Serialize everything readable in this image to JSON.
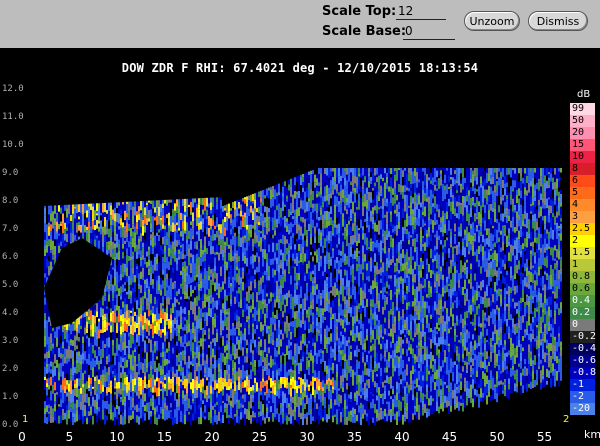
{
  "toolbar": {
    "scale_top_label": "Scale Top:",
    "scale_top_value": "12",
    "scale_base_label": "Scale Base:",
    "scale_base_value": "0",
    "unzoom_label": "Unzoom",
    "dismiss_label": "Dismiss"
  },
  "plot": {
    "title": "DOW ZDR F  RHI: 67.4021 deg  -  12/10/2015 18:13:54",
    "x_unit": "km",
    "y_ticks": [
      "12.0",
      "11.0",
      "10.0",
      "9.0",
      "8.0",
      "7.0",
      "6.0",
      "5.0",
      "4.0",
      "3.0",
      "2.0",
      "1.0",
      "0.0"
    ],
    "x_ticks": [
      "0",
      "5",
      "10",
      "15",
      "20",
      "25",
      "30",
      "35",
      "40",
      "45",
      "50",
      "55"
    ],
    "corner_left": "1",
    "corner_right": "2"
  },
  "colorbar": {
    "unit": "dB",
    "entries": [
      {
        "label": "99",
        "color": "#ffd8e4"
      },
      {
        "label": "50",
        "color": "#ffb0c8"
      },
      {
        "label": "20",
        "color": "#ff8fb0"
      },
      {
        "label": "15",
        "color": "#ff5577"
      },
      {
        "label": "10",
        "color": "#ee2244"
      },
      {
        "label": "8",
        "color": "#d81e28"
      },
      {
        "label": "6",
        "color": "#ff4a1a"
      },
      {
        "label": "5",
        "color": "#ff6a1a"
      },
      {
        "label": "4",
        "color": "#ff8a2a"
      },
      {
        "label": "3",
        "color": "#ffa040"
      },
      {
        "label": "2.5",
        "color": "#ffd000"
      },
      {
        "label": "2",
        "color": "#ffff00"
      },
      {
        "label": "1.5",
        "color": "#e0e040"
      },
      {
        "label": "1",
        "color": "#b8c838"
      },
      {
        "label": "0.8",
        "color": "#8fb83a"
      },
      {
        "label": "0.6",
        "color": "#6aa83a"
      },
      {
        "label": "0.4",
        "color": "#4a9840"
      },
      {
        "label": "0.2",
        "color": "#3e8a48"
      },
      {
        "label": "0",
        "color": "#7a7a7a"
      },
      {
        "label": "-0.2",
        "color": "#202020"
      },
      {
        "label": "-0.4",
        "color": "#000060"
      },
      {
        "label": "-0.6",
        "color": "#000090"
      },
      {
        "label": "-0.8",
        "color": "#0000c0"
      },
      {
        "label": "-1",
        "color": "#0020e0"
      },
      {
        "label": "-2",
        "color": "#2a5ce8"
      },
      {
        "label": "-20",
        "color": "#4a80e8"
      }
    ]
  }
}
